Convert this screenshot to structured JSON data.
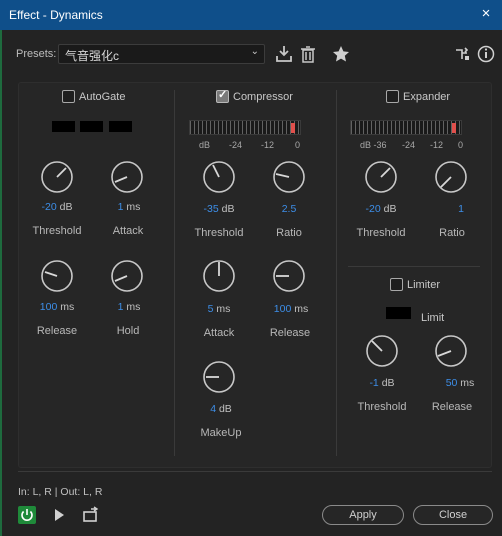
{
  "window": {
    "title": "Effect - Dynamics",
    "close": "×"
  },
  "presets": {
    "label": "Presets:",
    "value": "气音强化c"
  },
  "autogate": {
    "label": "AutoGate",
    "checked": false,
    "threshold": {
      "value": "-20",
      "unit": "dB",
      "label": "Threshold"
    },
    "attack": {
      "value": "1",
      "unit": "ms",
      "label": "Attack"
    },
    "release": {
      "value": "100",
      "unit": "ms",
      "label": "Release"
    },
    "hold": {
      "value": "1",
      "unit": "ms",
      "label": "Hold"
    }
  },
  "compressor": {
    "label": "Compressor",
    "checked": true,
    "meter_scale": [
      "dB",
      "-24",
      "-12",
      "0"
    ],
    "threshold": {
      "value": "-35",
      "unit": "dB",
      "label": "Threshold"
    },
    "ratio": {
      "value": "2.5",
      "unit": "",
      "label": "Ratio"
    },
    "attack": {
      "value": "5",
      "unit": "ms",
      "label": "Attack"
    },
    "release": {
      "value": "100",
      "unit": "ms",
      "label": "Release"
    },
    "makeup": {
      "value": "4",
      "unit": "dB",
      "label": "MakeUp"
    }
  },
  "expander": {
    "label": "Expander",
    "checked": false,
    "meter_scale": [
      "dB -36",
      "-24",
      "-12",
      "0"
    ],
    "threshold": {
      "value": "-20",
      "unit": "dB",
      "label": "Threshold"
    },
    "ratio": {
      "value": "1",
      "unit": "",
      "label": "Ratio"
    }
  },
  "limiter": {
    "label": "Limiter",
    "checked": false,
    "indicator_label": "Limit",
    "threshold": {
      "value": "-1",
      "unit": "dB",
      "label": "Threshold"
    },
    "release": {
      "value": "50",
      "unit": "ms",
      "label": "Release"
    }
  },
  "footer": {
    "io": "In: L, R | Out: L, R",
    "apply": "Apply",
    "close": "Close"
  },
  "colors": {
    "accent": "#3d8ee8",
    "titlebar": "#0f4f8a",
    "power": "#1f8a3a",
    "peak": "#e0504c"
  },
  "icons": [
    "download-icon",
    "trash-icon",
    "star-icon",
    "routing-icon",
    "info-icon",
    "power-icon",
    "play-icon",
    "loop-icon",
    "chevron-down-icon"
  ]
}
